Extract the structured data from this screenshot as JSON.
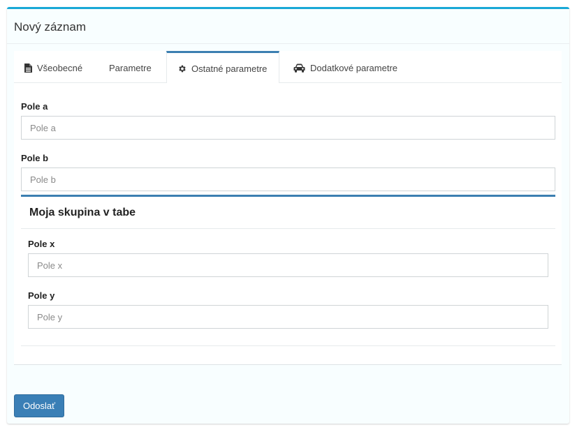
{
  "header": {
    "title": "Nový záznam"
  },
  "tabs": [
    {
      "label": "Všeobecné",
      "icon": "file-icon",
      "active": false
    },
    {
      "label": "Parametre",
      "icon": "",
      "active": false
    },
    {
      "label": "Ostatné parametre",
      "icon": "gear-icon",
      "active": true
    },
    {
      "label": "Dodatkové parametre",
      "icon": "car-icon",
      "active": false
    }
  ],
  "fields": {
    "a": {
      "label": "Pole a",
      "placeholder": "Pole a",
      "value": ""
    },
    "b": {
      "label": "Pole b",
      "placeholder": "Pole b",
      "value": ""
    }
  },
  "group": {
    "title": "Moja skupina v tabe",
    "fields": {
      "x": {
        "label": "Pole x",
        "placeholder": "Pole x",
        "value": ""
      },
      "y": {
        "label": "Pole y",
        "placeholder": "Pole y",
        "value": ""
      }
    }
  },
  "footer": {
    "submit_label": "Odoslať"
  },
  "colors": {
    "box_top_border": "#18a8d6",
    "tab_active_border": "#3c7fb1",
    "group_border": "#3c7fb1",
    "button_bg": "#3a7fb6"
  }
}
